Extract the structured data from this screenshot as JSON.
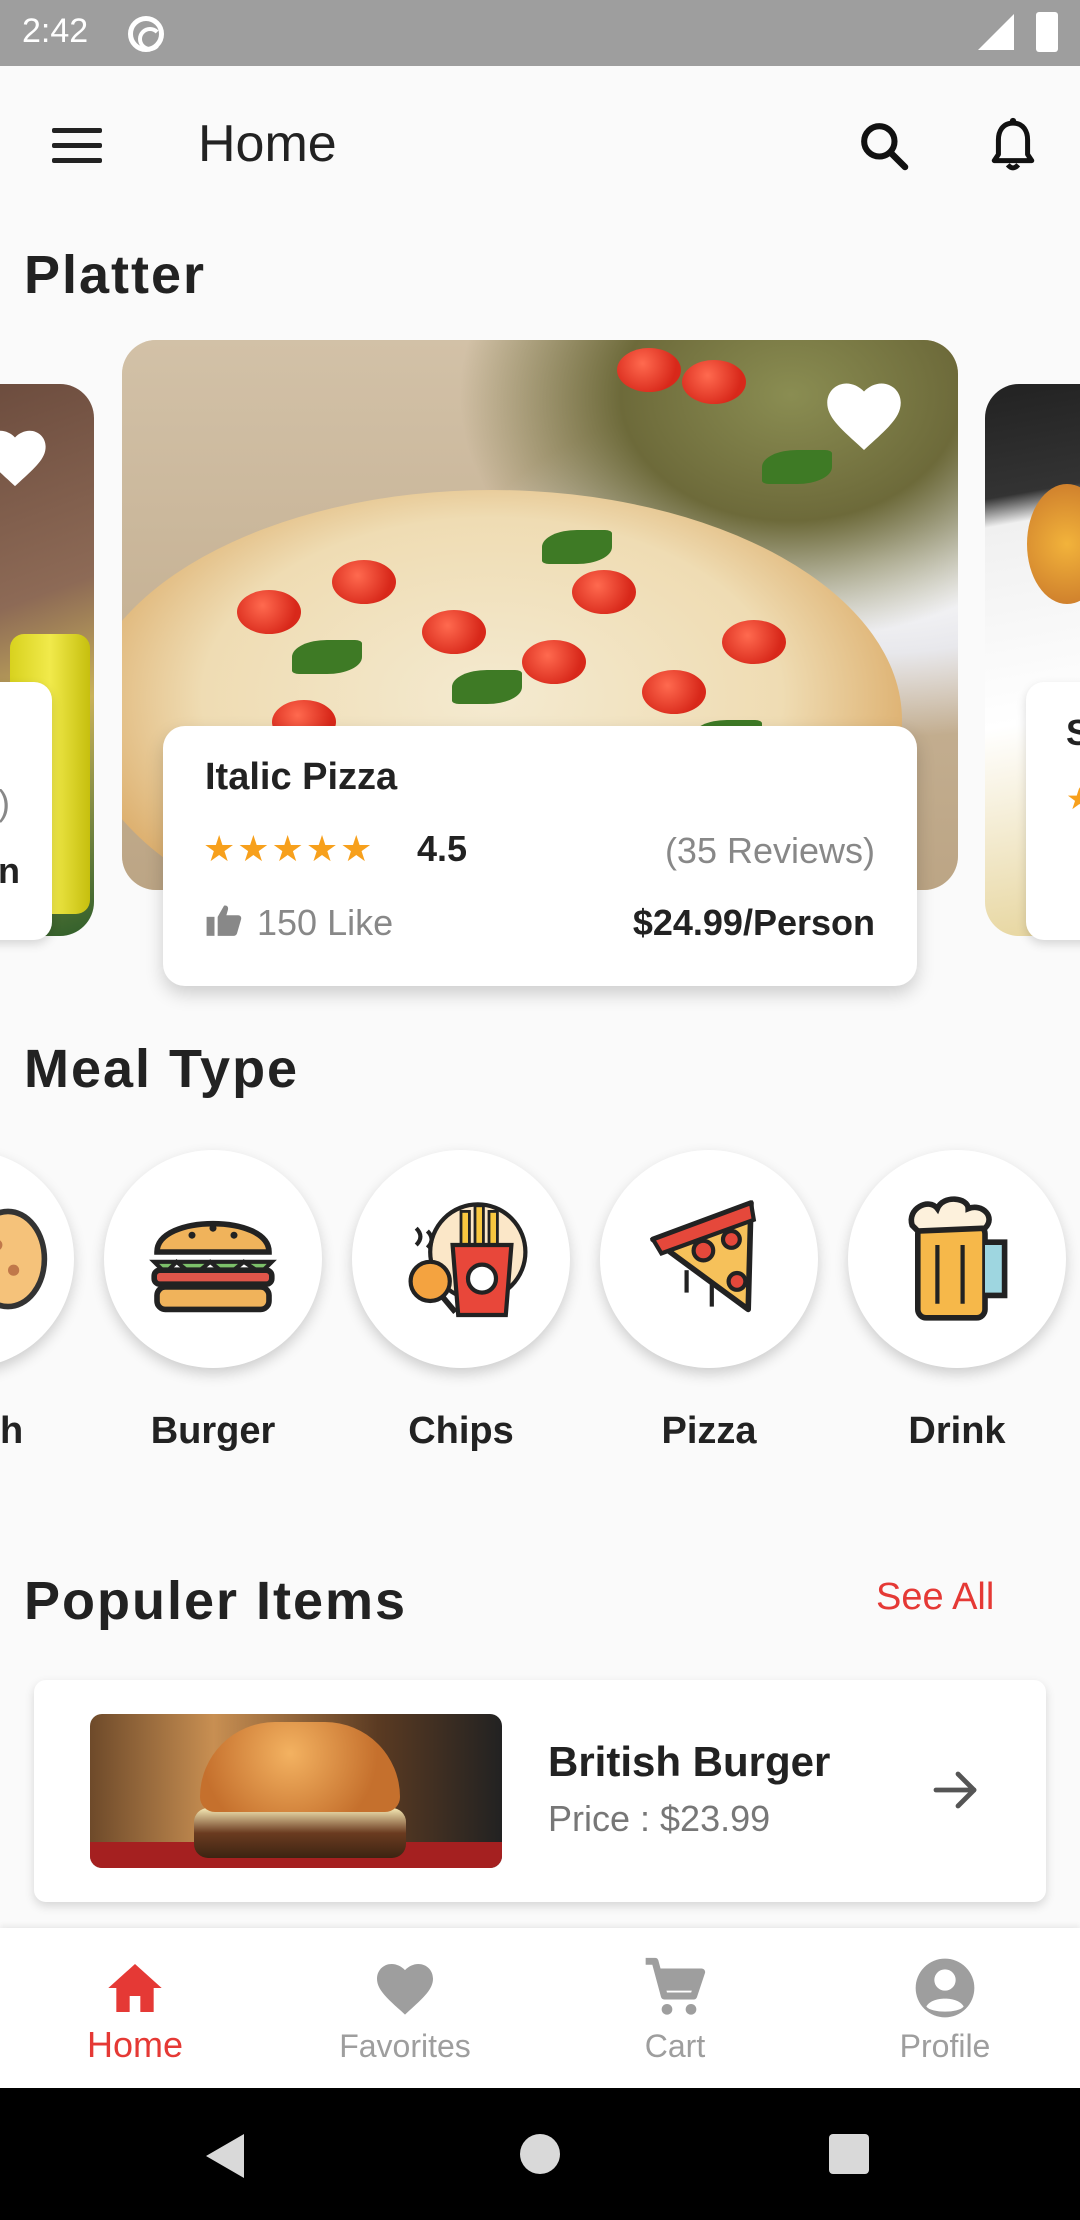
{
  "status_bar": {
    "time": "2:42"
  },
  "app_bar": {
    "title": "Home"
  },
  "platter": {
    "section_title": "Platter",
    "featured": {
      "name": "Italic Pizza",
      "stars": "★★★★★",
      "rating": "4.5",
      "reviews": "(35 Reviews)",
      "likes": "150 Like",
      "price": "$24.99/Person"
    },
    "left_partial_text": {
      "line1": ")",
      "line2": "n"
    },
    "right_partial_text": {
      "line1": "S",
      "line2": "★"
    }
  },
  "meal_type": {
    "section_title": "Meal Type",
    "partial_label": "h",
    "items": [
      {
        "label": "Burger",
        "icon": "burger-icon"
      },
      {
        "label": "Chips",
        "icon": "chips-icon"
      },
      {
        "label": "Pizza",
        "icon": "pizza-icon"
      },
      {
        "label": "Drink",
        "icon": "drink-icon"
      }
    ]
  },
  "popular": {
    "section_title": "Populer Items",
    "see_all": "See All",
    "items": [
      {
        "name": "British Burger",
        "price": "Price : $23.99"
      }
    ]
  },
  "bottom_nav": {
    "items": [
      {
        "label": "Home",
        "icon": "home-icon",
        "active": true
      },
      {
        "label": "Favorites",
        "icon": "heart-icon",
        "active": false
      },
      {
        "label": "Cart",
        "icon": "cart-icon",
        "active": false
      },
      {
        "label": "Profile",
        "icon": "profile-icon",
        "active": false
      }
    ]
  },
  "colors": {
    "accent": "#e53935",
    "star": "#f7a01c",
    "background": "#fafafa"
  }
}
